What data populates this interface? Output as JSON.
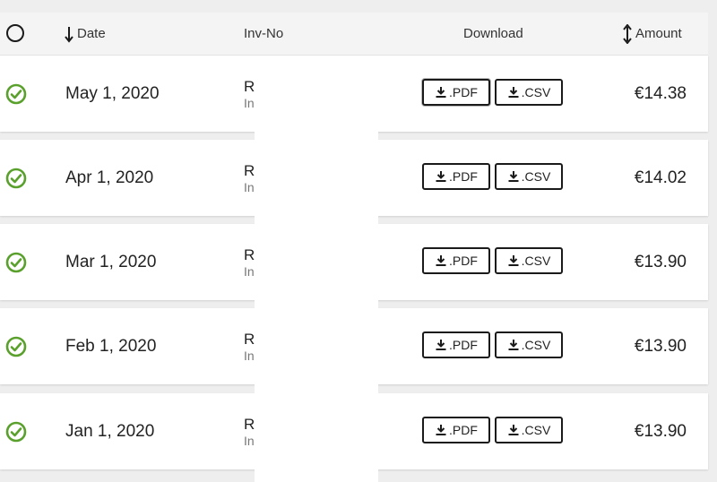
{
  "header": {
    "date_label": "Date",
    "invno_label": "Inv-No",
    "download_label": "Download",
    "amount_label": "Amount"
  },
  "rows": [
    {
      "date": "May 1, 2020",
      "inv_main": "R",
      "inv_sub": "In",
      "pdf": ".PDF",
      "csv": ".CSV",
      "amount": "€14.38"
    },
    {
      "date": "Apr 1, 2020",
      "inv_main": "R",
      "inv_sub": "In",
      "pdf": ".PDF",
      "csv": ".CSV",
      "amount": "€14.02"
    },
    {
      "date": "Mar 1, 2020",
      "inv_main": "R",
      "inv_sub": "In",
      "pdf": ".PDF",
      "csv": ".CSV",
      "amount": "€13.90"
    },
    {
      "date": "Feb 1, 2020",
      "inv_main": "R",
      "inv_sub": "In",
      "pdf": ".PDF",
      "csv": ".CSV",
      "amount": "€13.90"
    },
    {
      "date": "Jan 1, 2020",
      "inv_main": "R",
      "inv_sub": "In",
      "pdf": ".PDF",
      "csv": ".CSV",
      "amount": "€13.90"
    }
  ],
  "colors": {
    "check_green": "#5aa02c",
    "border_dark": "#1a1a1a"
  },
  "icons": [
    "circle-icon",
    "arrow-down-icon",
    "arrow-updown-icon",
    "check-circle-icon",
    "download-icon"
  ]
}
